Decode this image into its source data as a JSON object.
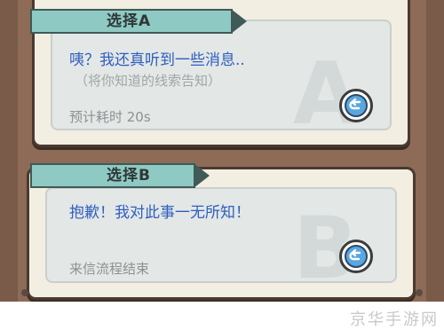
{
  "options": [
    {
      "title": "选择A",
      "reply": "咦？我还真听到一些消息..",
      "hint": "（将你知道的线索告知）",
      "meta": "预计耗时  20s",
      "letter": "A",
      "button_icon": "replay-arrow-icon"
    },
    {
      "title": "选择B",
      "reply": "抱歉！我对此事一无所知！",
      "meta": "来信流程结束",
      "letter": "B",
      "button_icon": "replay-arrow-icon"
    }
  ],
  "site_watermark": "京华手游网",
  "colors": {
    "ribbon": "#8fc9c3",
    "reply_text": "#2f5fbf",
    "button": "#5aa6e0"
  }
}
